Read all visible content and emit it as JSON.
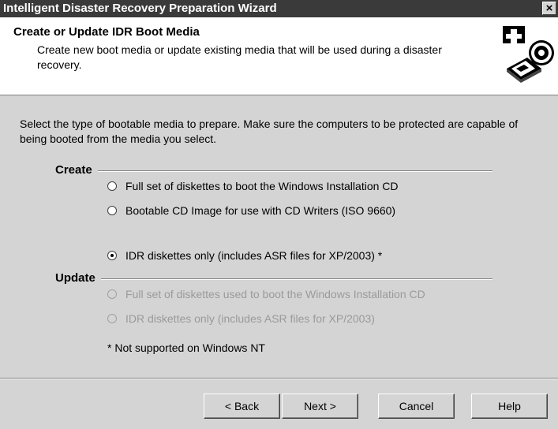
{
  "window": {
    "title": "Intelligent Disaster Recovery Preparation Wizard",
    "close_label": "×"
  },
  "header": {
    "title": "Create or Update IDR Boot Media",
    "description": "Create new boot media or update existing media that will be used during a disaster recovery.",
    "icon": "first-aid-cd-icon"
  },
  "intro": "Select the type of bootable media to prepare. Make sure the computers to be protected are capable of being booted from the media you select.",
  "create_group": {
    "label": "Create",
    "options": [
      {
        "label": "Full set of diskettes to boot the Windows Installation CD",
        "checked": false,
        "enabled": true
      },
      {
        "label": "Bootable CD Image for use with CD Writers (ISO 9660)",
        "checked": false,
        "enabled": true
      },
      {
        "label": "IDR diskettes only (includes ASR files for XP/2003) *",
        "checked": true,
        "enabled": true
      }
    ]
  },
  "update_group": {
    "label": "Update",
    "options": [
      {
        "label": "Full set of diskettes used to boot the Windows Installation CD",
        "checked": false,
        "enabled": false
      },
      {
        "label": "IDR diskettes only (includes ASR files for XP/2003)",
        "checked": false,
        "enabled": false
      }
    ]
  },
  "note": "* Not supported on Windows NT",
  "buttons": {
    "back": "< Back",
    "next": "Next >",
    "cancel": "Cancel",
    "help": "Help"
  }
}
